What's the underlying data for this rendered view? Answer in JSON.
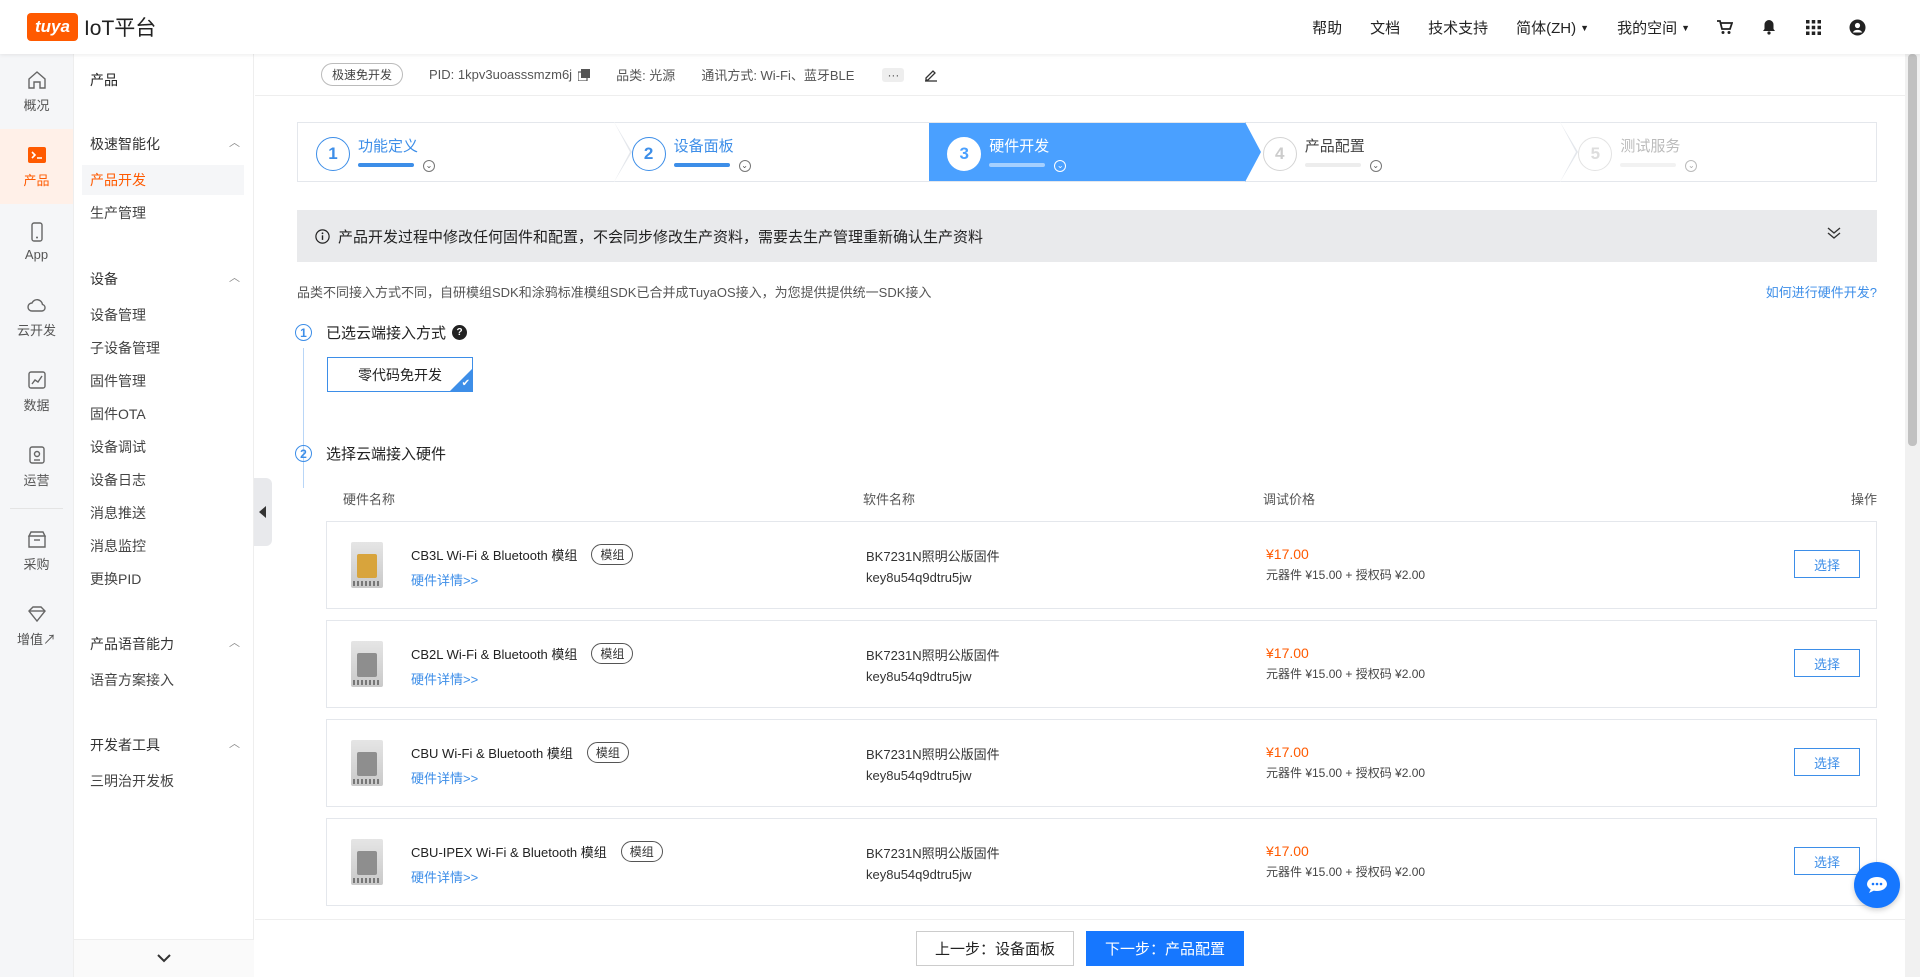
{
  "header": {
    "logo_badge": "tuya",
    "logo_text": "IoT平台",
    "nav": [
      "帮助",
      "文档",
      "技术支持",
      "简体(ZH)",
      "我的空间"
    ]
  },
  "rail": [
    {
      "label": "概况",
      "icon": "home-icon"
    },
    {
      "label": "产品",
      "icon": "terminal-icon",
      "active": true
    },
    {
      "label": "App",
      "icon": "phone-icon"
    },
    {
      "label": "云开发",
      "icon": "cloud-icon"
    },
    {
      "label": "数据",
      "icon": "chart-icon"
    },
    {
      "label": "运营",
      "icon": "operation-icon"
    },
    {
      "label": "采购",
      "icon": "shop-icon"
    },
    {
      "label": "增值↗",
      "icon": "diamond-icon"
    }
  ],
  "sidebar": {
    "title": "产品",
    "groups": [
      {
        "title": "极速智能化",
        "items": [
          "产品开发",
          "生产管理"
        ]
      },
      {
        "title": "设备",
        "items": [
          "设备管理",
          "子设备管理",
          "固件管理",
          "固件OTA",
          "设备调试",
          "设备日志",
          "消息推送",
          "消息监控",
          "更换PID"
        ]
      },
      {
        "title": "产品语音能力",
        "items": [
          "语音方案接入"
        ]
      },
      {
        "title": "开发者工具",
        "items": [
          "三明治开发板"
        ]
      }
    ]
  },
  "infobar": {
    "tag": "极速免开发",
    "pid": "PID: 1kpv3uoasssmzm6j",
    "category": "品类: 光源",
    "protocol": "通讯方式: Wi-Fi、蓝牙BLE",
    "more": "···"
  },
  "steps": [
    {
      "num": "1",
      "label": "功能定义"
    },
    {
      "num": "2",
      "label": "设备面板"
    },
    {
      "num": "3",
      "label": "硬件开发"
    },
    {
      "num": "4",
      "label": "产品配置"
    },
    {
      "num": "5",
      "label": "测试服务"
    }
  ],
  "notice": "产品开发过程中修改任何固件和配置，不会同步修改生产资料，需要去生产管理重新确认生产资料",
  "description": "品类不同接入方式不同，自研模组SDK和涂鸦标准模组SDK已合并成TuyaOS接入，为您提供提供统一SDK接入",
  "howto_link": "如何进行硬件开发?",
  "section1": {
    "num": "1",
    "title": "已选云端接入方式",
    "help": "?",
    "choice": "零代码免开发"
  },
  "section2": {
    "num": "2",
    "title": "选择云端接入硬件"
  },
  "table": {
    "headers": [
      "硬件名称",
      "软件名称",
      "调试价格",
      "操作"
    ],
    "rows": [
      {
        "name": "CB3L Wi-Fi & Bluetooth 模组",
        "type": "模组",
        "detail": "硬件详情>>",
        "software": "BK7231N照明公版固件",
        "key": "key8u54q9dtru5jw",
        "price": "¥17.00",
        "breakdown": "元器件 ¥15.00 + 授权码 ¥2.00",
        "action": "选择"
      },
      {
        "name": "CB2L Wi-Fi & Bluetooth 模组",
        "type": "模组",
        "detail": "硬件详情>>",
        "software": "BK7231N照明公版固件",
        "key": "key8u54q9dtru5jw",
        "price": "¥17.00",
        "breakdown": "元器件 ¥15.00 + 授权码 ¥2.00",
        "action": "选择"
      },
      {
        "name": "CBU Wi-Fi & Bluetooth 模组",
        "type": "模组",
        "detail": "硬件详情>>",
        "software": "BK7231N照明公版固件",
        "key": "key8u54q9dtru5jw",
        "price": "¥17.00",
        "breakdown": "元器件 ¥15.00 + 授权码 ¥2.00",
        "action": "选择"
      },
      {
        "name": "CBU-IPEX Wi-Fi & Bluetooth 模组",
        "type": "模组",
        "detail": "硬件详情>>",
        "software": "BK7231N照明公版固件",
        "key": "key8u54q9dtru5jw",
        "price": "¥17.00",
        "breakdown": "元器件 ¥15.00 + 授权码 ¥2.00",
        "action": "选择"
      }
    ]
  },
  "footer": {
    "prev": "上一步：设备面板",
    "next": "下一步：产品配置"
  },
  "colors": {
    "brand": "#ff5a00",
    "accent": "#3d8ee8",
    "primary_button": "#1677ff",
    "current_step": "#4aa0ff"
  }
}
